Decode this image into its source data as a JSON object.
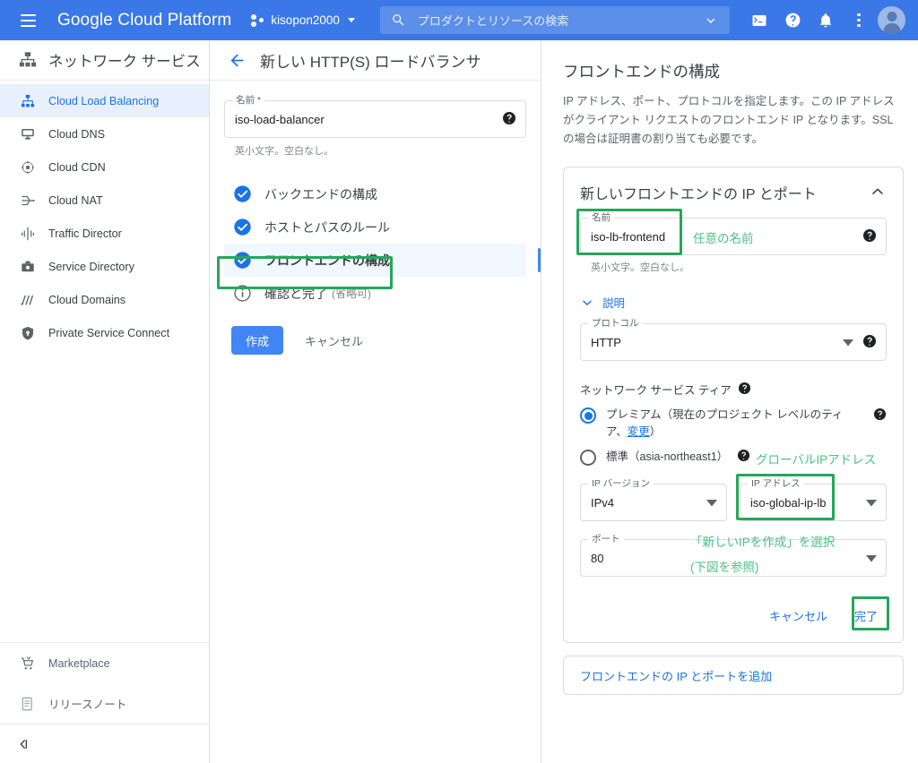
{
  "topbar": {
    "menu_icon": "hamburger-icon",
    "brand": "Google Cloud Platform",
    "project": "kisopon2000",
    "search_placeholder": "プロダクトとリソースの検索",
    "icons": [
      "cloud-shell-icon",
      "help-icon",
      "notifications-icon",
      "more-options-icon",
      "account-avatar"
    ]
  },
  "sidebar": {
    "title": "ネットワーク サービス",
    "title_icon": "network-services-icon",
    "items": [
      {
        "label": "Cloud Load Balancing",
        "icon": "load-balancing-icon",
        "active": true
      },
      {
        "label": "Cloud DNS",
        "icon": "dns-icon",
        "active": false
      },
      {
        "label": "Cloud CDN",
        "icon": "cdn-icon",
        "active": false
      },
      {
        "label": "Cloud NAT",
        "icon": "nat-icon",
        "active": false
      },
      {
        "label": "Traffic Director",
        "icon": "traffic-director-icon",
        "active": false
      },
      {
        "label": "Service Directory",
        "icon": "service-directory-icon",
        "active": false
      },
      {
        "label": "Cloud Domains",
        "icon": "domains-icon",
        "active": false
      },
      {
        "label": "Private Service Connect",
        "icon": "private-service-connect-icon",
        "active": false
      }
    ],
    "footer": [
      {
        "label": "Marketplace",
        "icon": "marketplace-icon"
      },
      {
        "label": "リリースノート",
        "icon": "release-notes-icon"
      }
    ],
    "collapse_icon": "collapse-sidebar-icon"
  },
  "middle": {
    "back_icon": "back-arrow-icon",
    "title": "新しい HTTP(S) ロードバランサ",
    "name_field": {
      "label": "名前 *",
      "value": "iso-load-balancer",
      "hint": "英小文字。空白なし。",
      "help_icon": "help-icon"
    },
    "steps": [
      {
        "label": "バックエンドの構成",
        "sub": "",
        "state": "done",
        "selected": false
      },
      {
        "label": "ホストとパスのルール",
        "sub": "",
        "state": "done",
        "selected": false
      },
      {
        "label": "フロントエンドの構成",
        "sub": "",
        "state": "done",
        "selected": true
      },
      {
        "label": "確認と完了",
        "sub": "(省略可)",
        "state": "info",
        "selected": false
      }
    ],
    "create_button": "作成",
    "cancel_button": "キャンセル"
  },
  "right": {
    "title": "フロントエンドの構成",
    "description": "IP アドレス、ポート、プロトコルを指定します。この IP アドレスがクライアント リクエストのフロントエンド IP となります。SSL の場合は証明書の割り当ても必要です。",
    "card": {
      "title": "新しいフロントエンドの IP とポート",
      "collapse_icon": "chevron-up-icon",
      "name_field": {
        "label": "名前",
        "value": "iso-lb-frontend",
        "hint": "英小文字。空白なし。",
        "help_icon": "help-icon"
      },
      "description_expander": {
        "label": "説明",
        "icon": "chevron-down-icon"
      },
      "protocol_field": {
        "label": "プロトコル",
        "value": "HTTP",
        "caret_icon": "dropdown-caret-icon",
        "help_icon": "help-icon"
      },
      "tier": {
        "heading": "ネットワーク サービス ティア",
        "heading_help_icon": "help-icon",
        "options": [
          {
            "label_before_link": "プレミアム（現在のプロジェクト レベルのティア、",
            "link": "変更",
            "label_after_link": "）",
            "selected": true,
            "help_icon": "help-icon"
          },
          {
            "label_before_link": "標準（asia-northeast1）",
            "link": "",
            "label_after_link": "",
            "selected": false,
            "help_icon": "help-icon"
          }
        ]
      },
      "ip_version_field": {
        "label": "IP バージョン",
        "value": "IPv4",
        "caret_icon": "dropdown-caret-icon"
      },
      "ip_address_field": {
        "label": "IP アドレス",
        "value": "iso-global-ip-lb",
        "caret_icon": "dropdown-caret-icon"
      },
      "port_field": {
        "label": "ポート",
        "value": "80",
        "caret_icon": "dropdown-caret-icon"
      },
      "cancel_button": "キャンセル",
      "done_button": "完了"
    },
    "add_frontend_link": "フロントエンドの IP とポートを追加"
  },
  "annotations": {
    "color_box": "#25a75a",
    "color_text": "#4cc184",
    "note_any_name": "任意の名前",
    "note_global_ip": "グローバルIPアドレス",
    "note_create_new_ip": "「新しいIPを作成」を選択",
    "note_see_below": "(下図を参照)"
  }
}
